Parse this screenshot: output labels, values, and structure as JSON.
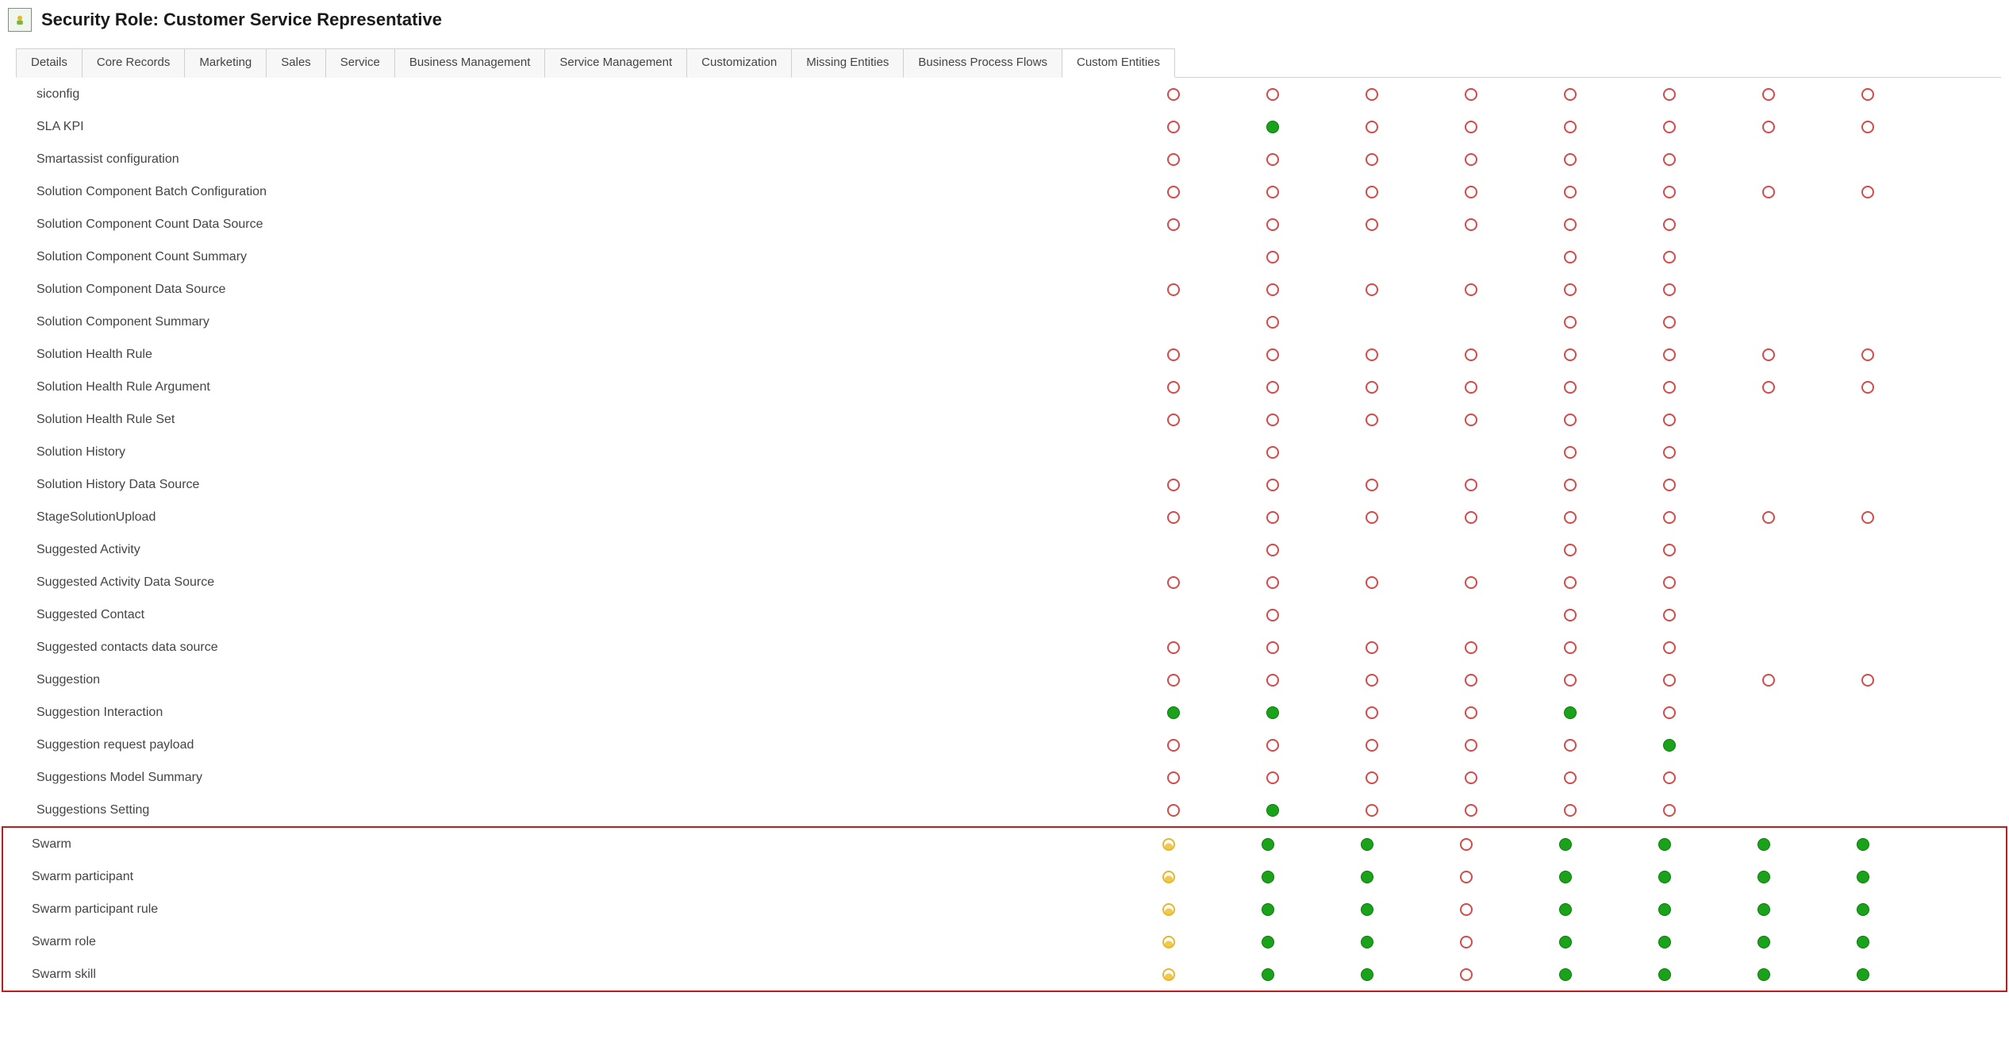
{
  "header": {
    "title": "Security Role: Customer Service Representative"
  },
  "tabs": [
    {
      "label": "Details",
      "active": false
    },
    {
      "label": "Core Records",
      "active": false
    },
    {
      "label": "Marketing",
      "active": false
    },
    {
      "label": "Sales",
      "active": false
    },
    {
      "label": "Service",
      "active": false
    },
    {
      "label": "Business Management",
      "active": false
    },
    {
      "label": "Service Management",
      "active": false
    },
    {
      "label": "Customization",
      "active": false
    },
    {
      "label": "Missing Entities",
      "active": false
    },
    {
      "label": "Business Process Flows",
      "active": false
    },
    {
      "label": "Custom Entities",
      "active": true
    }
  ],
  "privilegeColumns": 8,
  "rows": [
    {
      "name": "siconfig",
      "priv": [
        "none",
        "none",
        "none",
        "none",
        "none",
        "none",
        "none",
        "none"
      ]
    },
    {
      "name": "SLA KPI",
      "priv": [
        "none",
        "org",
        "none",
        "none",
        "none",
        "none",
        "none",
        "none"
      ]
    },
    {
      "name": "Smartassist configuration",
      "priv": [
        "none",
        "none",
        "none",
        "none",
        "none",
        "none",
        "",
        ""
      ]
    },
    {
      "name": "Solution Component Batch Configuration",
      "priv": [
        "none",
        "none",
        "none",
        "none",
        "none",
        "none",
        "none",
        "none"
      ]
    },
    {
      "name": "Solution Component Count Data Source",
      "priv": [
        "none",
        "none",
        "none",
        "none",
        "none",
        "none",
        "",
        ""
      ]
    },
    {
      "name": "Solution Component Count Summary",
      "priv": [
        "",
        "none",
        "",
        "",
        "none",
        "none",
        "",
        ""
      ]
    },
    {
      "name": "Solution Component Data Source",
      "priv": [
        "none",
        "none",
        "none",
        "none",
        "none",
        "none",
        "",
        ""
      ]
    },
    {
      "name": "Solution Component Summary",
      "priv": [
        "",
        "none",
        "",
        "",
        "none",
        "none",
        "",
        ""
      ]
    },
    {
      "name": "Solution Health Rule",
      "priv": [
        "none",
        "none",
        "none",
        "none",
        "none",
        "none",
        "none",
        "none"
      ]
    },
    {
      "name": "Solution Health Rule Argument",
      "priv": [
        "none",
        "none",
        "none",
        "none",
        "none",
        "none",
        "none",
        "none"
      ]
    },
    {
      "name": "Solution Health Rule Set",
      "priv": [
        "none",
        "none",
        "none",
        "none",
        "none",
        "none",
        "",
        ""
      ]
    },
    {
      "name": "Solution History",
      "priv": [
        "",
        "none",
        "",
        "",
        "none",
        "none",
        "",
        ""
      ]
    },
    {
      "name": "Solution History Data Source",
      "priv": [
        "none",
        "none",
        "none",
        "none",
        "none",
        "none",
        "",
        ""
      ]
    },
    {
      "name": "StageSolutionUpload",
      "priv": [
        "none",
        "none",
        "none",
        "none",
        "none",
        "none",
        "none",
        "none"
      ]
    },
    {
      "name": "Suggested Activity",
      "priv": [
        "",
        "none",
        "",
        "",
        "none",
        "none",
        "",
        ""
      ]
    },
    {
      "name": "Suggested Activity Data Source",
      "priv": [
        "none",
        "none",
        "none",
        "none",
        "none",
        "none",
        "",
        ""
      ]
    },
    {
      "name": "Suggested Contact",
      "priv": [
        "",
        "none",
        "",
        "",
        "none",
        "none",
        "",
        ""
      ]
    },
    {
      "name": "Suggested contacts data source",
      "priv": [
        "none",
        "none",
        "none",
        "none",
        "none",
        "none",
        "",
        ""
      ]
    },
    {
      "name": "Suggestion",
      "priv": [
        "none",
        "none",
        "none",
        "none",
        "none",
        "none",
        "none",
        "none"
      ]
    },
    {
      "name": "Suggestion Interaction",
      "priv": [
        "org",
        "org",
        "none",
        "none",
        "org",
        "none",
        "",
        ""
      ]
    },
    {
      "name": "Suggestion request payload",
      "priv": [
        "none",
        "none",
        "none",
        "none",
        "none",
        "org",
        "",
        ""
      ]
    },
    {
      "name": "Suggestions Model Summary",
      "priv": [
        "none",
        "none",
        "none",
        "none",
        "none",
        "none",
        "",
        ""
      ]
    },
    {
      "name": "Suggestions Setting",
      "priv": [
        "none",
        "org",
        "none",
        "none",
        "none",
        "none",
        "",
        ""
      ]
    }
  ],
  "highlightedRows": [
    {
      "name": "Swarm",
      "priv": [
        "user",
        "org",
        "org",
        "none",
        "org",
        "org",
        "org",
        "org"
      ]
    },
    {
      "name": "Swarm participant",
      "priv": [
        "user",
        "org",
        "org",
        "none",
        "org",
        "org",
        "org",
        "org"
      ]
    },
    {
      "name": "Swarm participant rule",
      "priv": [
        "user",
        "org",
        "org",
        "none",
        "org",
        "org",
        "org",
        "org"
      ]
    },
    {
      "name": "Swarm role",
      "priv": [
        "user",
        "org",
        "org",
        "none",
        "org",
        "org",
        "org",
        "org"
      ]
    },
    {
      "name": "Swarm skill",
      "priv": [
        "user",
        "org",
        "org",
        "none",
        "org",
        "org",
        "org",
        "org"
      ]
    }
  ]
}
